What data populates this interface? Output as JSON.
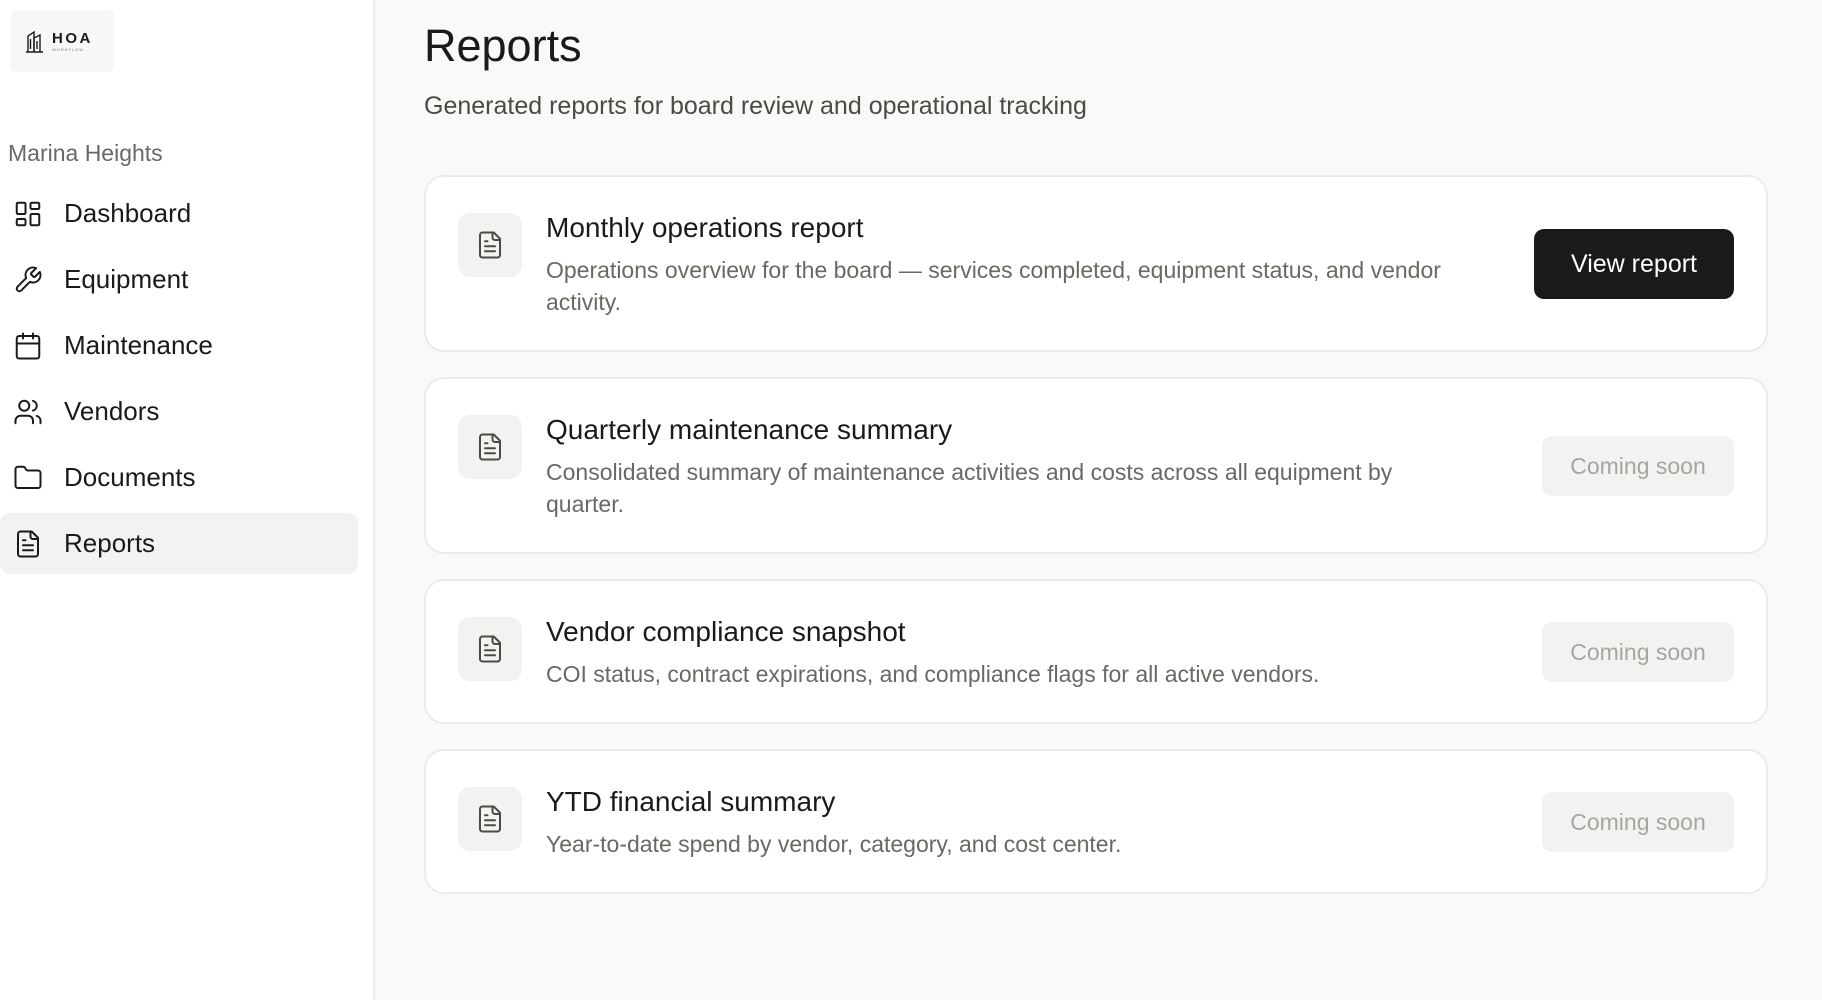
{
  "brand": {
    "name": "HOA",
    "tagline": "WORKFLOW"
  },
  "sidebar": {
    "org_name": "Marina Heights",
    "items": [
      {
        "label": "Dashboard",
        "icon": "dashboard-icon"
      },
      {
        "label": "Equipment",
        "icon": "wrench-icon"
      },
      {
        "label": "Maintenance",
        "icon": "calendar-icon"
      },
      {
        "label": "Vendors",
        "icon": "users-icon"
      },
      {
        "label": "Documents",
        "icon": "folder-icon"
      },
      {
        "label": "Reports",
        "icon": "file-text-icon",
        "active": true
      }
    ]
  },
  "page": {
    "title": "Reports",
    "subtitle": "Generated reports for board review and operational tracking"
  },
  "reports": [
    {
      "title": "Monthly operations report",
      "description": "Operations overview for the board — services completed, equipment status, and vendor activity.",
      "action": "View report",
      "enabled": true
    },
    {
      "title": "Quarterly maintenance summary",
      "description": "Consolidated summary of maintenance activities and costs across all equipment by quarter.",
      "action": "Coming soon",
      "enabled": false
    },
    {
      "title": "Vendor compliance snapshot",
      "description": "COI status, contract expirations, and compliance flags for all active vendors.",
      "action": "Coming soon",
      "enabled": false
    },
    {
      "title": "YTD financial summary",
      "description": "Year-to-date spend by vendor, category, and cost center.",
      "action": "Coming soon",
      "enabled": false
    }
  ],
  "colors": {
    "background": "#f9f9f8",
    "sidebar": "#ffffff",
    "primary_button": "#1c1a18",
    "disabled_button": "#f2f2f1",
    "active_nav": "#f2f2f1"
  }
}
